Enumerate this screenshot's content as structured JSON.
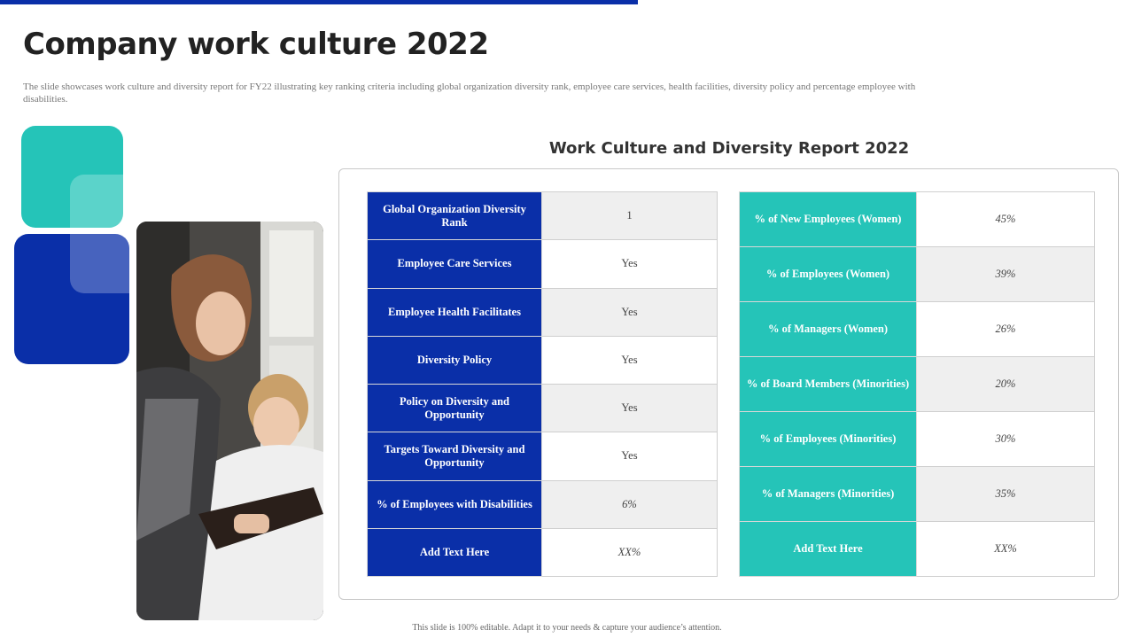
{
  "page": {
    "title": "Company work culture 2022",
    "subtitle": "The slide showcases work culture and diversity report for FY22 illustrating key ranking criteria including  global  organization diversity rank, employee care services, health facilities, diversity policy and percentage employee with disabilities.",
    "footer": "This slide is 100% editable. Adapt it to your needs & capture your audience’s attention."
  },
  "report": {
    "title": "Work Culture and Diversity Report 2022",
    "left_table": [
      {
        "label": "Global  Organization Diversity Rank",
        "value": "1"
      },
      {
        "label": "Employee   Care Services",
        "value": "Yes"
      },
      {
        "label": "Employee   Health Facilitates",
        "value": "Yes"
      },
      {
        "label": "Diversity Policy",
        "value": "Yes"
      },
      {
        "label": "Policy on Diversity  and Opportunity",
        "value": "Yes"
      },
      {
        "label": "Targets Toward  Diversity and Opportunity",
        "value": "Yes"
      },
      {
        "label": "% of Employees  with Disabilities",
        "value": "6%"
      },
      {
        "label": "Add  Text Here",
        "value": "XX%"
      }
    ],
    "right_table": [
      {
        "label": "% of New  Employees  (Women)",
        "value": "45%"
      },
      {
        "label": "% of Employees  (Women)",
        "value": "39%"
      },
      {
        "label": "% of Managers  (Women)",
        "value": "26%"
      },
      {
        "label": "% of Board  Members  (Minorities)",
        "value": "20%"
      },
      {
        "label": "% of Employees  (Minorities)",
        "value": "30%"
      },
      {
        "label": "% of Managers  (Minorities)",
        "value": "35%"
      },
      {
        "label": "Add  Text Here",
        "value": "XX%"
      }
    ]
  },
  "colors": {
    "primary_blue": "#0a2fa8",
    "teal": "#25c4b8",
    "cell_shade": "#efefef"
  },
  "icons": {
    "photo": "people-reviewing-document-photo"
  }
}
